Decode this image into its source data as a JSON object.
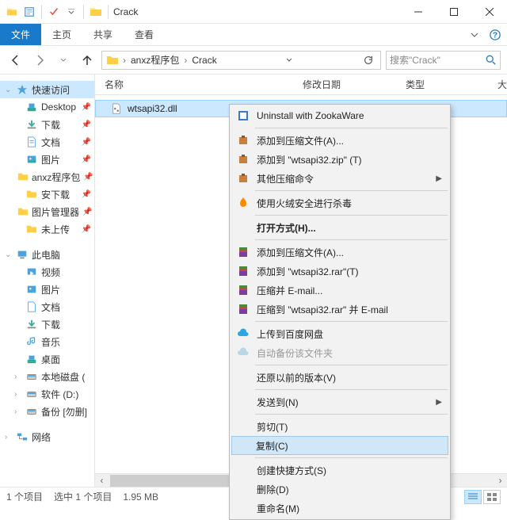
{
  "window": {
    "title": "Crack"
  },
  "ribbon": {
    "file": "文件",
    "home": "主页",
    "share": "共享",
    "view": "查看"
  },
  "breadcrumb": {
    "seg1": "anxz程序包",
    "seg2": "Crack"
  },
  "search": {
    "placeholder": "搜索\"Crack\""
  },
  "sidebar": {
    "quick": "快速访问",
    "items": [
      "Desktop",
      "下载",
      "文档",
      "图片",
      "anxz程序包",
      "安下载",
      "图片管理器",
      "未上传"
    ],
    "thispc": "此电脑",
    "pc_items": [
      "视频",
      "图片",
      "文档",
      "下载",
      "音乐",
      "桌面",
      "本地磁盘 (",
      "软件 (D:)",
      "备份 [勿删]"
    ],
    "network": "网络"
  },
  "columns": {
    "name": "名称",
    "date": "修改日期",
    "type": "类型",
    "size": "大"
  },
  "file": {
    "name": "wtsapi32.dll"
  },
  "context": {
    "uninstall": "Uninstall with ZookaWare",
    "addzip": "添加到压缩文件(A)...",
    "addzip2": "添加到 \"wtsapi32.zip\" (T)",
    "otherzip": "其他压缩命令",
    "huorong": "使用火绒安全进行杀毒",
    "openwith": "打开方式(H)...",
    "addrar": "添加到压缩文件(A)...",
    "addrar2": "添加到 \"wtsapi32.rar\"(T)",
    "rarmail": "压缩并 E-mail...",
    "rarmail2": "压缩到 \"wtsapi32.rar\" 并 E-mail",
    "baidu": "上传到百度网盘",
    "autobak": "自动备份该文件夹",
    "restore": "还原以前的版本(V)",
    "sendto": "发送到(N)",
    "cut": "剪切(T)",
    "copy": "复制(C)",
    "shortcut": "创建快捷方式(S)",
    "delete": "删除(D)",
    "rename": "重命名(M)"
  },
  "status": {
    "count": "1 个项目",
    "selected": "选中 1 个项目",
    "size": "1.95 MB"
  },
  "colors": {
    "accent": "#1979ca",
    "selection": "#cce8ff"
  }
}
